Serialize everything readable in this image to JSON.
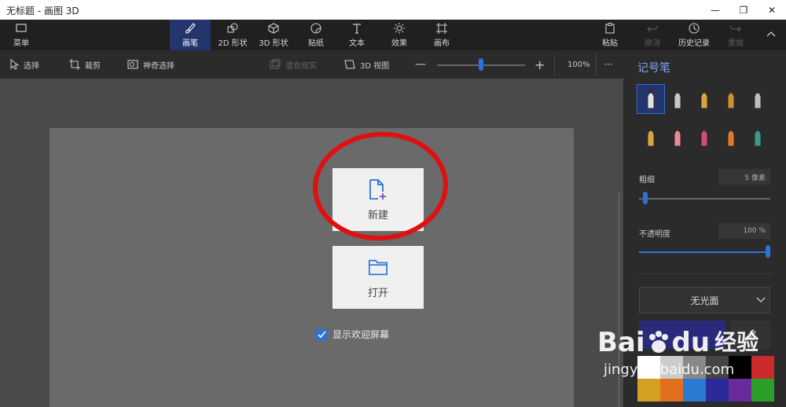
{
  "window": {
    "title": "无标题 - 画图 3D",
    "min_glyph": "—",
    "max_glyph": "❐",
    "close_glyph": "✕"
  },
  "toolbar": {
    "menu": "菜单",
    "tools": [
      "画笔",
      "2D 形状",
      "3D 形状",
      "贴纸",
      "文本",
      "效果",
      "画布"
    ],
    "paste": "粘贴",
    "undo": "撤消",
    "history": "历史记录",
    "redo": "重做"
  },
  "subbar": {
    "select": "选择",
    "crop": "裁剪",
    "magic_select": "神奇选择",
    "mixed_reality": "混合现实",
    "view3d": "3D 视图",
    "zoom_minus": "—",
    "zoom_plus": "+",
    "zoom": "100%",
    "more": "···",
    "zoom_level": 0.5
  },
  "welcome": {
    "new_label": "新建",
    "open_label": "打开",
    "show_welcome": "显示欢迎屏幕",
    "show_welcome_checked": true
  },
  "panel": {
    "title": "记号笔",
    "thickness_label": "粗细",
    "thickness_value": "5 像素",
    "thickness_level": 0.05,
    "opacity_label": "不透明度",
    "opacity_value": "100 %",
    "opacity_level": 1.0,
    "finish": "无光面",
    "current_color": "#2a2a7a",
    "brushes": [
      {
        "name": "marker",
        "color": "#e0e0e0"
      },
      {
        "name": "calligraphy-pen",
        "color": "#c8c8c8"
      },
      {
        "name": "oil-brush",
        "color": "#d9a441"
      },
      {
        "name": "watercolor",
        "color": "#c9922f"
      },
      {
        "name": "pixel-pen",
        "color": "#bdbdbd"
      },
      {
        "name": "pencil",
        "color": "#d9a441"
      },
      {
        "name": "eraser",
        "color": "#e88a9a"
      },
      {
        "name": "crayon",
        "color": "#d24a7a"
      },
      {
        "name": "spray-can",
        "color": "#e07a2a"
      },
      {
        "name": "fill",
        "color": "#3a9a8a"
      }
    ],
    "palette": [
      "#ffffff",
      "#cccccc",
      "#888888",
      "#444444",
      "#000000",
      "#cc2a2a",
      "#d4a020",
      "#e07020",
      "#2a7ad4",
      "#2a2a9a",
      "#6a2a9a",
      "#2aa02a"
    ]
  },
  "watermark": {
    "brand": "Bai",
    "brand2": "du",
    "jingyan": "经验",
    "url": "jingyan.baidu.com"
  },
  "colors": {
    "accent": "#2a74d6",
    "active_tool": "#24346c",
    "highlight_circle": "#e01010"
  }
}
